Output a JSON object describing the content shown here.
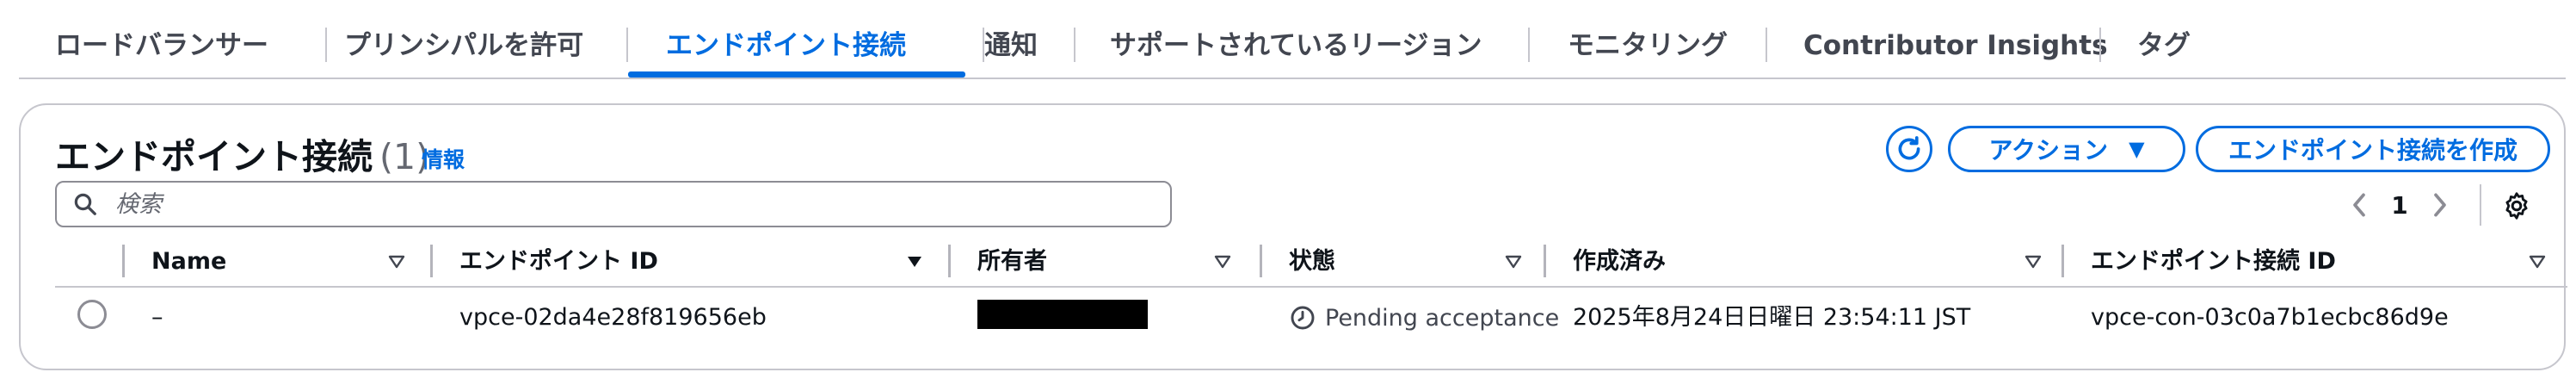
{
  "tabs": [
    {
      "label": "ロードバランサー"
    },
    {
      "label": "プリンシパルを許可"
    },
    {
      "label": "エンドポイント接続"
    },
    {
      "label": "通知"
    },
    {
      "label": "サポートされているリージョン"
    },
    {
      "label": "モニタリング"
    },
    {
      "label": "Contributor Insights"
    },
    {
      "label": "タグ"
    }
  ],
  "active_tab": "エンドポイント接続",
  "panel": {
    "title": "エンドポイント接続",
    "count": "(1)",
    "info_label": "情報",
    "refresh_icon": "refresh-icon",
    "actions_label": "アクション",
    "create_label": "エンドポイント接続を作成",
    "search_placeholder": "検索",
    "page_number": "1"
  },
  "table": {
    "columns": [
      {
        "label": "Name"
      },
      {
        "label": "エンドポイント ID"
      },
      {
        "label": "所有者"
      },
      {
        "label": "状態"
      },
      {
        "label": "作成済み"
      },
      {
        "label": "エンドポイント接続 ID"
      }
    ],
    "rows": [
      {
        "name": "–",
        "endpoint_id": "vpce-02da4e28f819656eb",
        "owner": "",
        "state": "Pending acceptance",
        "created": "2025年8月24日日曜日 23:54:11 JST",
        "connection_id": "vpce-con-03c0a7b1ecbc86d9e"
      }
    ]
  },
  "colors": {
    "accent": "#006ce0",
    "text": "#0f141a",
    "muted": "#424650",
    "border": "#c6c6cd"
  }
}
